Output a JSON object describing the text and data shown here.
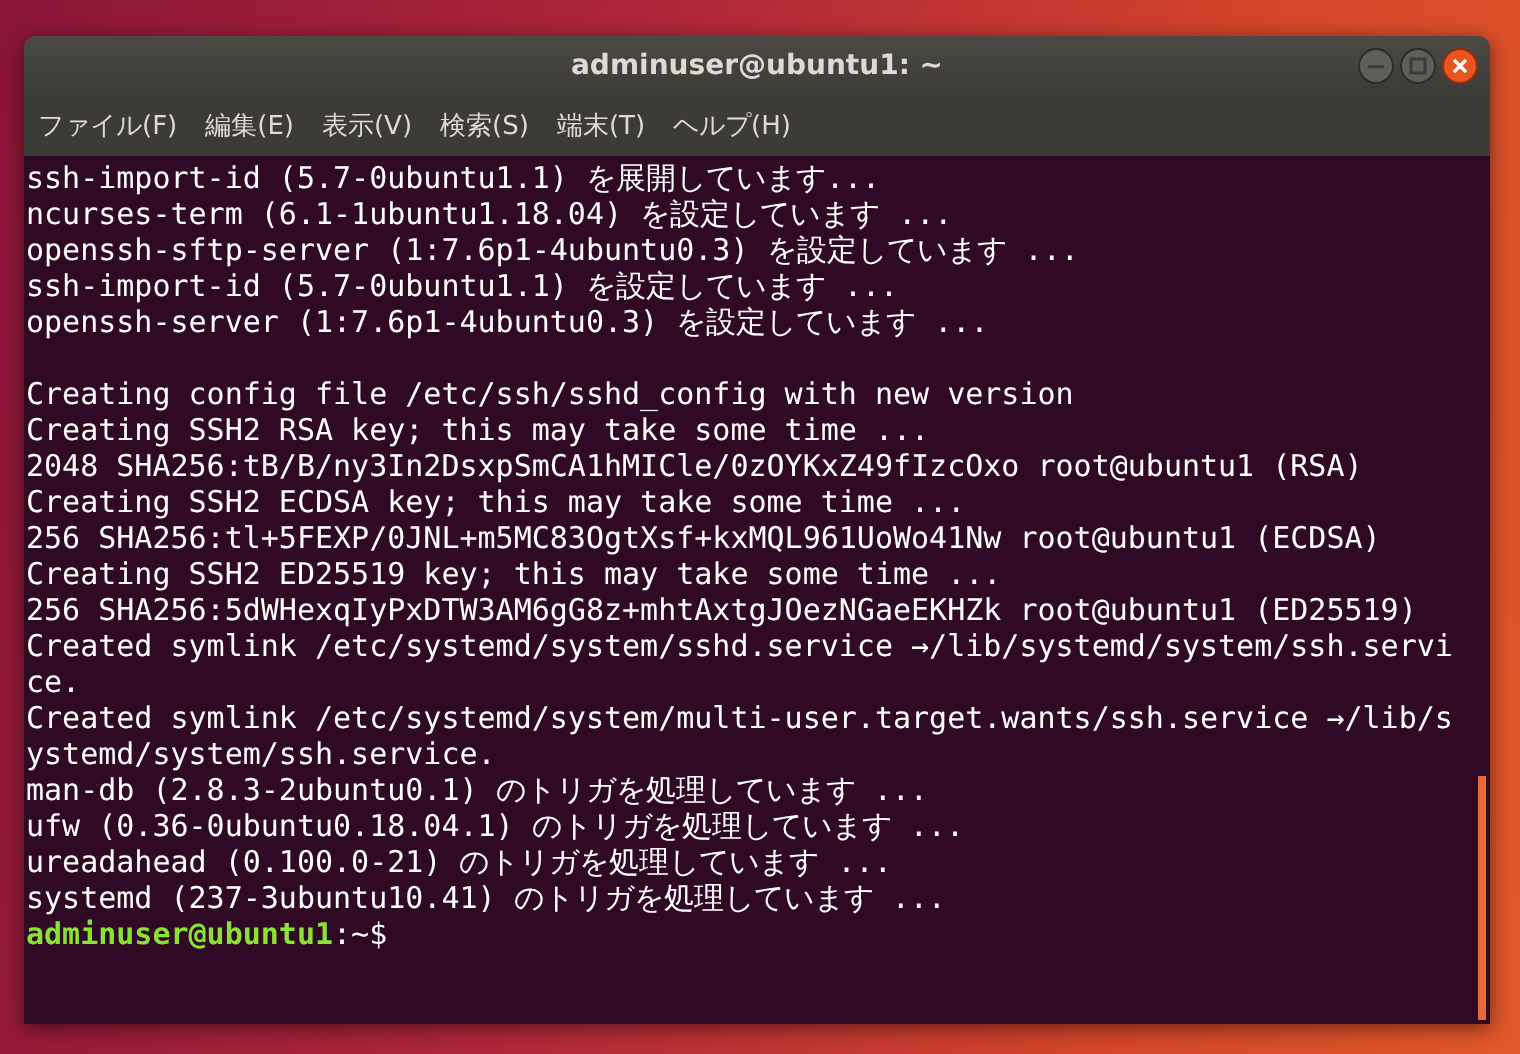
{
  "window": {
    "title": "adminuser@ubuntu1: ~"
  },
  "menu": [
    "ファイル(F)",
    "編集(E)",
    "表示(V)",
    "検索(S)",
    "端末(T)",
    "ヘルプ(H)"
  ],
  "terminal": {
    "output_blocks": [
      [
        "ssh-import-id (5.7-0ubuntu1.1) を展開しています...",
        "ncurses-term (6.1-1ubuntu1.18.04) を設定しています ...",
        "openssh-sftp-server (1:7.6p1-4ubuntu0.3) を設定しています ...",
        "ssh-import-id (5.7-0ubuntu1.1) を設定しています ...",
        "openssh-server (1:7.6p1-4ubuntu0.3) を設定しています ..."
      ],
      [
        "Creating config file /etc/ssh/sshd_config with new version",
        "Creating SSH2 RSA key; this may take some time ...",
        "2048 SHA256:tB/B/ny3In2DsxpSmCA1hMICle/0zOYKxZ49fIzcOxo root@ubuntu1 (RSA)",
        "Creating SSH2 ECDSA key; this may take some time ...",
        "256 SHA256:tl+5FEXP/0JNL+m5MC83OgtXsf+kxMQL961UoWo41Nw root@ubuntu1 (ECDSA)",
        "Creating SSH2 ED25519 key; this may take some time ...",
        "256 SHA256:5dWHexqIyPxDTW3AM6gG8z+mhtAxtgJOezNGaeEKHZk root@ubuntu1 (ED25519)",
        "Created symlink /etc/systemd/system/sshd.service →/lib/systemd/system/ssh.servi",
        "ce.",
        "Created symlink /etc/systemd/system/multi-user.target.wants/ssh.service →/lib/s",
        "ystemd/system/ssh.service.",
        "man-db (2.8.3-2ubuntu0.1) のトリガを処理しています ...",
        "ufw (0.36-0ubuntu0.18.04.1) のトリガを処理しています ...",
        "ureadahead (0.100.0-21) のトリガを処理しています ...",
        "systemd (237-3ubuntu10.41) のトリガを処理しています ..."
      ]
    ],
    "prompt": {
      "user_host": "adminuser@ubuntu1",
      "path": ":~$"
    }
  }
}
